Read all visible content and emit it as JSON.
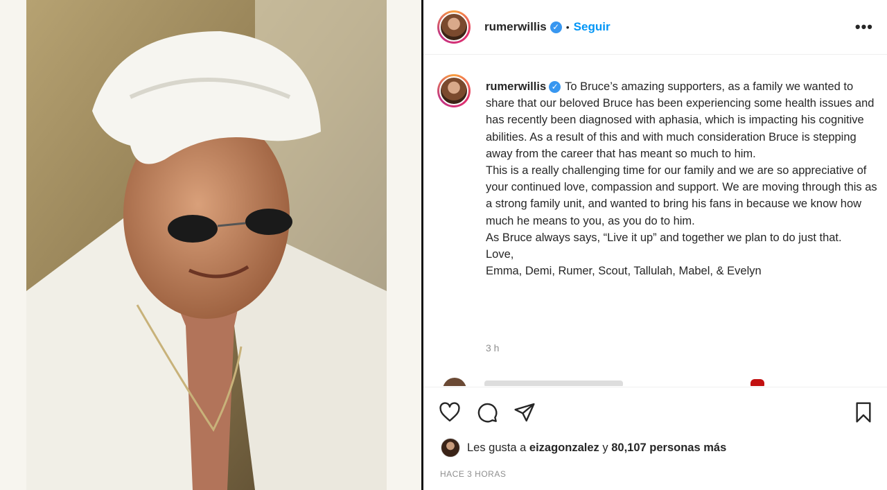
{
  "header": {
    "username": "rumerwillis",
    "verified_icon": "verified-badge-icon",
    "separator": "•",
    "follow_label": "Seguir",
    "more_icon": "•••"
  },
  "caption": {
    "username": "rumerwillis",
    "paragraphs": [
      "To Bruce’s amazing supporters, as a family we wanted to share that our beloved Bruce has been experiencing some health issues and has recently been diagnosed with aphasia, which is impacting his cognitive abilities. As a result of this and with much consideration Bruce is stepping away from the career that has meant so much to him.",
      "This is a really challenging time for our family and we are so appreciative of your continued love, compassion and support. We are moving through this as a strong family unit, and wanted to bring his fans in because we know how much he means to you, as you do to him.",
      "As Bruce always says, “Live it up” and together we plan to do just that.",
      "Love,",
      "Emma, Demi, Rumer, Scout, Tallulah, Mabel, & Evelyn"
    ],
    "time": "3 h"
  },
  "likes": {
    "prefix": "Les gusta a",
    "user": "eizagonzalez",
    "conj": "y",
    "count": "80,107 personas más"
  },
  "posted": "HACE 3 HORAS",
  "colors": {
    "accent": "#0095f6",
    "text": "#262626",
    "muted": "#8e8e8e"
  }
}
